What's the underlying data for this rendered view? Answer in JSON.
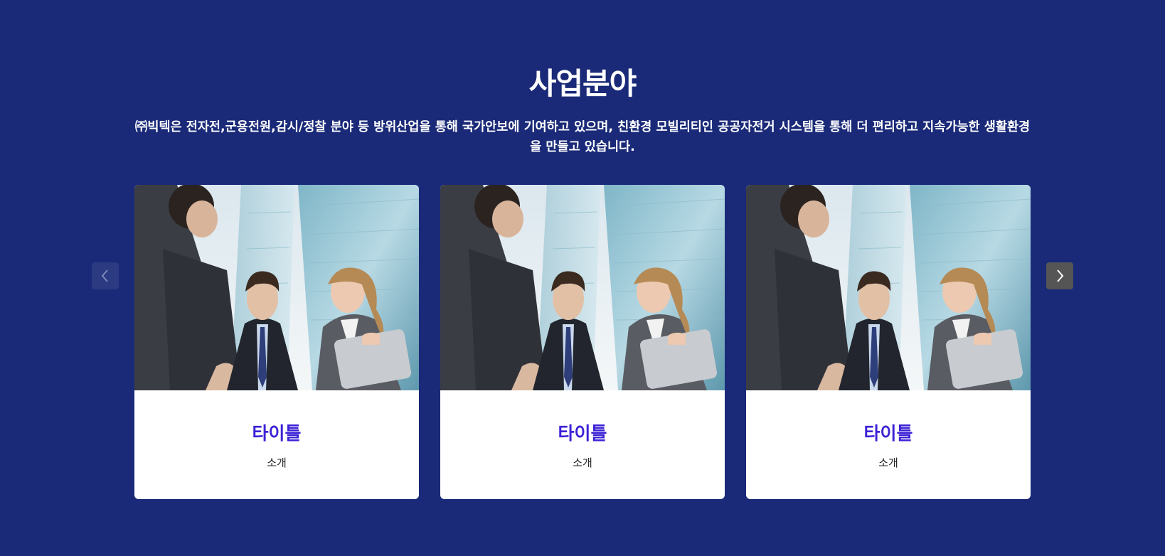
{
  "section": {
    "title": "사업분야",
    "description": "㈜빅텍은 전자전,군용전원,감시/정찰 분야 등 방위산업을 통해 국가안보에 기여하고 있으며, 친환경 모빌리티인 공공자전거 시스템을 통해 더 편리하고 지속가능한 생활환경을 만들고 있습니다."
  },
  "carousel": {
    "prev_icon": "chevron-left-icon",
    "next_icon": "chevron-right-icon",
    "cards": [
      {
        "title": "타이틀",
        "text": "소개",
        "image": "business-people-handshake-photo"
      },
      {
        "title": "타이틀",
        "text": "소개",
        "image": "business-people-handshake-photo"
      },
      {
        "title": "타이틀",
        "text": "소개",
        "image": "business-people-handshake-photo"
      }
    ]
  },
  "colors": {
    "background": "#1a2a78",
    "card_title": "#3b22d6",
    "prev_button": "#2c3a82",
    "next_button": "#555555"
  }
}
